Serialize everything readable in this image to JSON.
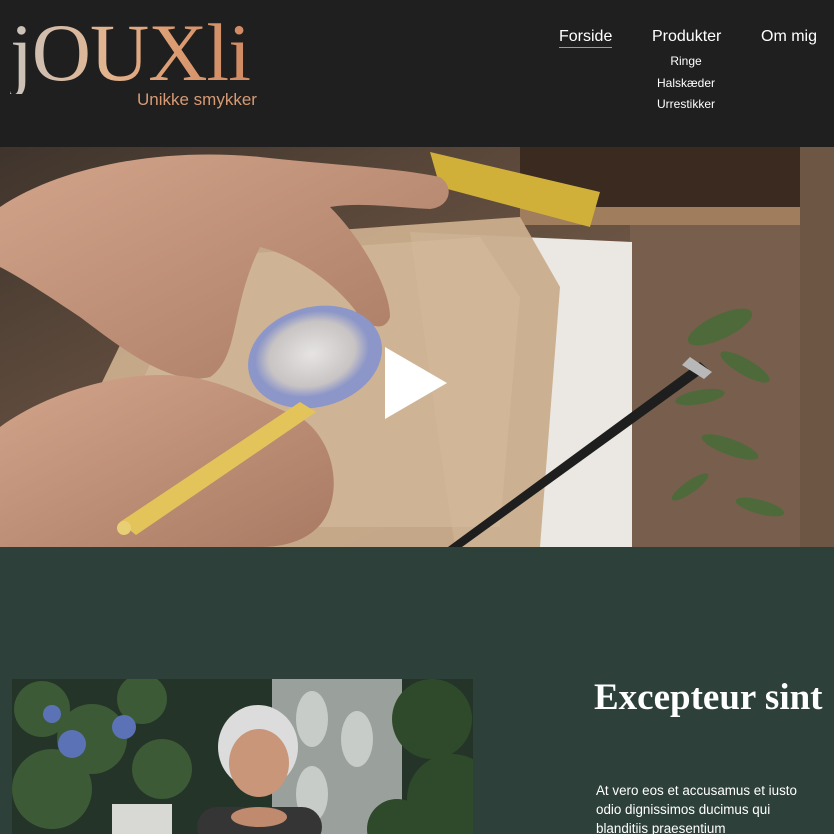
{
  "logo": {
    "title": "jOUXli",
    "subtitle": "Unikke smykker"
  },
  "nav": {
    "items": [
      {
        "label": "Forside",
        "active": true
      },
      {
        "label": "Produkter",
        "active": false
      },
      {
        "label": "Om mig",
        "active": false
      }
    ],
    "submenu": [
      "Ringe",
      "Halskæder",
      "Urrestikker"
    ]
  },
  "hero": {
    "media": "video",
    "play_icon": "play-icon"
  },
  "section": {
    "title": "Excepteur sint",
    "body": "At vero eos et accusamus et iusto odio dignissimos ducimus qui blanditiis praesentium"
  },
  "colors": {
    "header_bg": "#1f1f1f",
    "section_bg": "#2d4039",
    "accent": "#d79a73"
  }
}
